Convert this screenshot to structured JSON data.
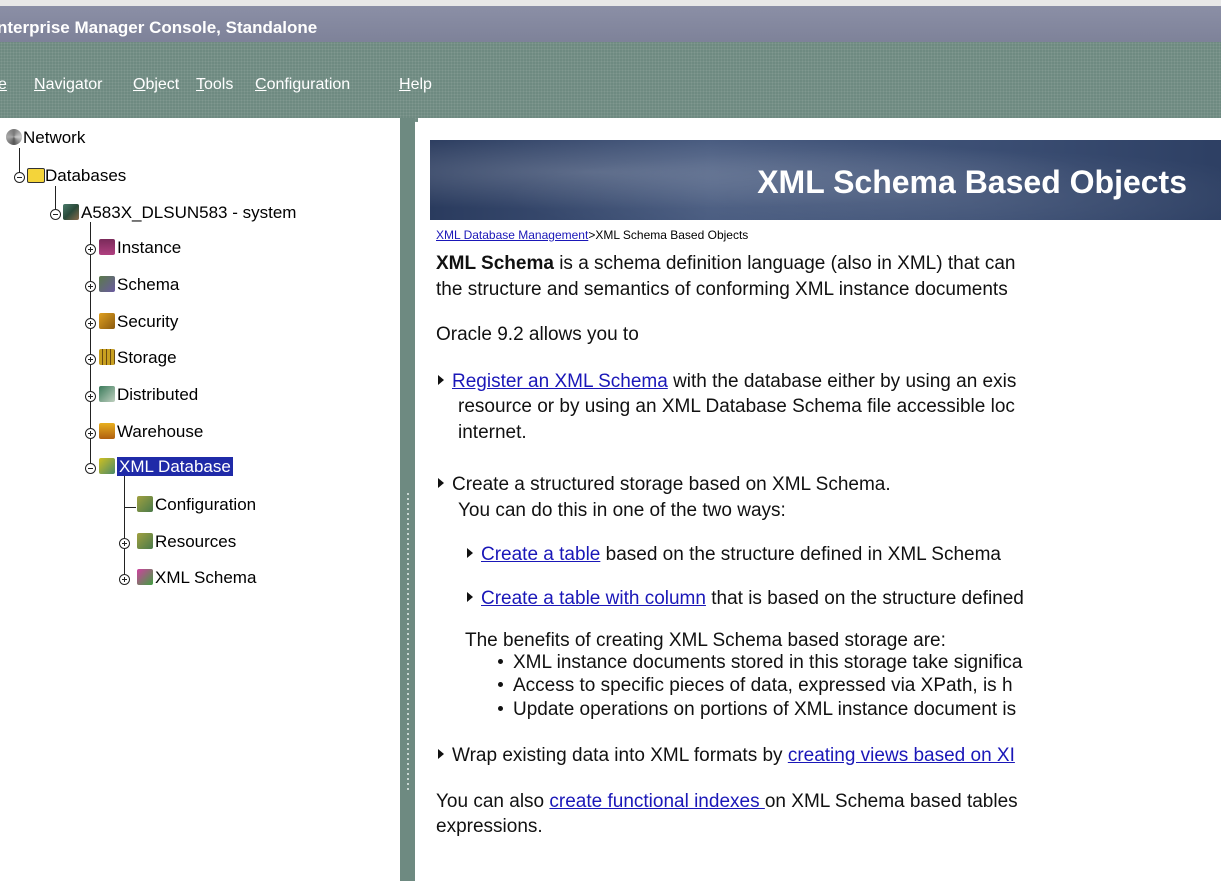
{
  "window": {
    "title": "nterprise Manager Console, Standalone"
  },
  "menu": [
    {
      "pre": "",
      "u": "e",
      "post": ""
    },
    {
      "pre": "",
      "u": "N",
      "post": "avigator"
    },
    {
      "pre": "",
      "u": "O",
      "post": "bject"
    },
    {
      "pre": "",
      "u": "T",
      "post": "ools"
    },
    {
      "pre": "",
      "u": "C",
      "post": "onfiguration"
    },
    {
      "pre": "",
      "u": "H",
      "post": "elp"
    }
  ],
  "tree": {
    "network": "Network",
    "databases": "Databases",
    "db": "A583X_DLSUN583 - system",
    "instance": "Instance",
    "schema": "Schema",
    "security": "Security",
    "storage": "Storage",
    "distributed": "Distributed",
    "warehouse": "Warehouse",
    "xmldb": "XML Database",
    "configuration": "Configuration",
    "resources": "Resources",
    "xmlschema": "XML Schema"
  },
  "content": {
    "banner": "XML Schema Based Objects",
    "crumb_link": "XML Database Management",
    "crumb_sep": ">",
    "crumb_current": "XML Schema Based Objects",
    "intro_bold": "XML Schema",
    "intro_1": " is a schema definition language (also in XML) that can",
    "intro_2": "the structure and semantics of conforming XML instance documents",
    "intro_3": "Oracle 9.2 allows you to",
    "item1_link": "Register an XML Schema",
    "item1_rest": " with the database either by using an exis",
    "item1_l2": "resource or by using an XML Database Schema file accessible loc",
    "item1_l3": "internet.",
    "item2_l1": "Create a structured storage based on XML Schema.",
    "item2_l2": "You can do this in one of the two ways:",
    "sub1_link": "Create a table",
    "sub1_rest": " based on the structure defined in XML Schema",
    "sub2_link": "Create a table with column",
    "sub2_rest": " that is based on the structure defined",
    "benefits": "The benefits of creating XML Schema based storage are:",
    "bullet1": "XML instance documents stored in this storage take significa",
    "bullet2": "Access to specific pieces of data, expressed via XPath, is h",
    "bullet3": "Update operations on portions of XML instance document is",
    "item3_pre": "Wrap existing data into XML formats by ",
    "item3_link": "creating views based on XI",
    "also_pre": "You can also ",
    "also_link": "create functional indexes ",
    "also_rest": "on XML Schema based tables",
    "also_l2": "expressions."
  },
  "colors": {
    "titlebar": "#8b8fa6",
    "menubar": "#6e8a81",
    "selection": "#1f2aa8",
    "link": "#1a17b8",
    "banner": "#3b4e73"
  }
}
